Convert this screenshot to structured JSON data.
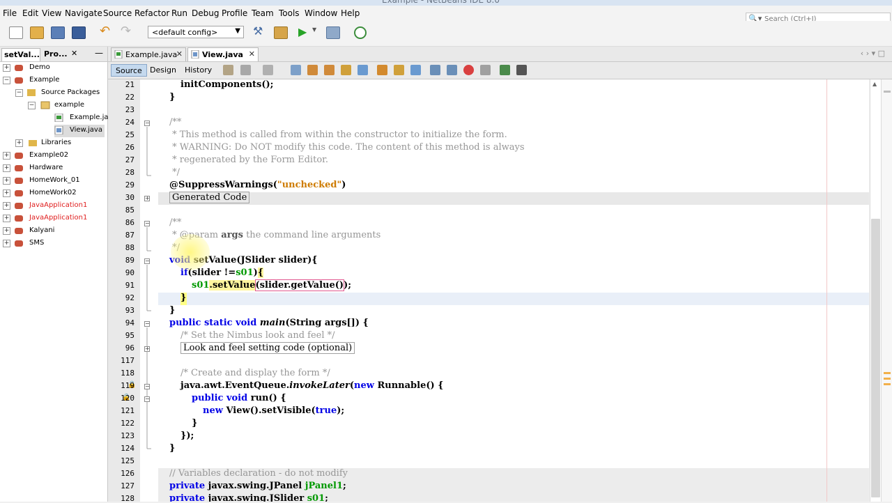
{
  "menu": [
    "File",
    "Edit",
    "View",
    "Navigate",
    "Source",
    "Refactor",
    "Run",
    "Debug",
    "Profile",
    "Team",
    "Tools",
    "Window",
    "Help"
  ],
  "search": {
    "placeholder": "Search (Ctrl+I)"
  },
  "toolbar": {
    "config_value": "<default config>"
  },
  "left_tabs": [
    "setVal...",
    "Pro..."
  ],
  "tree": [
    {
      "label": "Demo",
      "color": "#000000"
    },
    {
      "label": "Example",
      "color": "#000000"
    },
    {
      "label": "Source Packages",
      "color": "#000000"
    },
    {
      "label": "example",
      "color": "#000000"
    },
    {
      "label": "Example.ja",
      "color": "#000000"
    },
    {
      "label": "View.java",
      "color": "#000000"
    },
    {
      "label": "Libraries",
      "color": "#000000"
    },
    {
      "label": "Example02",
      "color": "#000000"
    },
    {
      "label": "Hardware",
      "color": "#000000"
    },
    {
      "label": "HomeWork_01",
      "color": "#000000"
    },
    {
      "label": "HomeWork02",
      "color": "#000000"
    },
    {
      "label": "JavaApplication1",
      "color": "#e02020"
    },
    {
      "label": "JavaApplication1",
      "color": "#e02020"
    },
    {
      "label": "Kalyani",
      "color": "#000000"
    },
    {
      "label": "SMS",
      "color": "#000000"
    }
  ],
  "editor_tabs": [
    "Example.java",
    "View.java"
  ],
  "editor_toolbar": {
    "source": "Source",
    "design": "Design",
    "history": "History"
  },
  "code": {
    "line_numbers": [
      "21",
      "22",
      "23",
      "24",
      "25",
      "26",
      "27",
      "28",
      "29",
      "30",
      "85",
      "86",
      "87",
      "88",
      "89",
      "90",
      "91",
      "92",
      "93",
      "94",
      "95",
      "96",
      "117",
      "118",
      "119",
      "120",
      "121",
      "122",
      "123",
      "124",
      "125",
      "126",
      "127",
      "128"
    ],
    "l21": "initComponents();",
    "brace": "}",
    "c_open": "/**",
    "c1": " * This method is called from within the constructor to initialize the form.",
    "c2": " * WARNING: Do NOT modify this code. The content of this method is always",
    "c3": " * regenerated by the Form Editor.",
    "c_close": " */",
    "ann": "@SuppressWarnings(",
    "ann_str": "\"unchecked\"",
    "ann_end": ")",
    "gen": "Generated Code",
    "p_star": " * @param ",
    "p_args": "args",
    "p_rest": " the command line arguments",
    "m_void": "void",
    "m_name": "setValue",
    "m_sig": "(JSlider slider){",
    "if_kw": "if",
    "if_a": "(slider !=",
    "if_f": "s01",
    "if_b": ")",
    "if_c": "{",
    "s_f": "s01",
    "s_dot": ".setValue",
    "s_arg": "(slider.getValue()",
    "s_end": ");",
    "close_brace": "}",
    "main_kw": "public static void ",
    "main_name": "main",
    "main_rest": "(String args[]) {",
    "c95": "/* Set the Nimbus look and feel */",
    "laf": "Look and feel setting code (optional)",
    "c117_empty": "",
    "c118": "/* Create and display the form */",
    "eq_a": "java.awt.EventQueue.",
    "eq_it": "invokeLater",
    "eq_b": "(",
    "eq_new": "new",
    "eq_c": " Runnable() {",
    "run_kw": "public void ",
    "run_rest": "run() {",
    "view_new": "new",
    "view_a": " View().setVisible(",
    "view_true": "true",
    "view_b": ");",
    "l123": "});",
    "l126": "// Variables declaration - do not modify",
    "p_kw": "private",
    "l127_t": " javax.swing.JPanel ",
    "l127_f": "jPanel1",
    "semi": ";",
    "l128_t": " javax.swing.JSlider ",
    "l128_f": "s01"
  }
}
